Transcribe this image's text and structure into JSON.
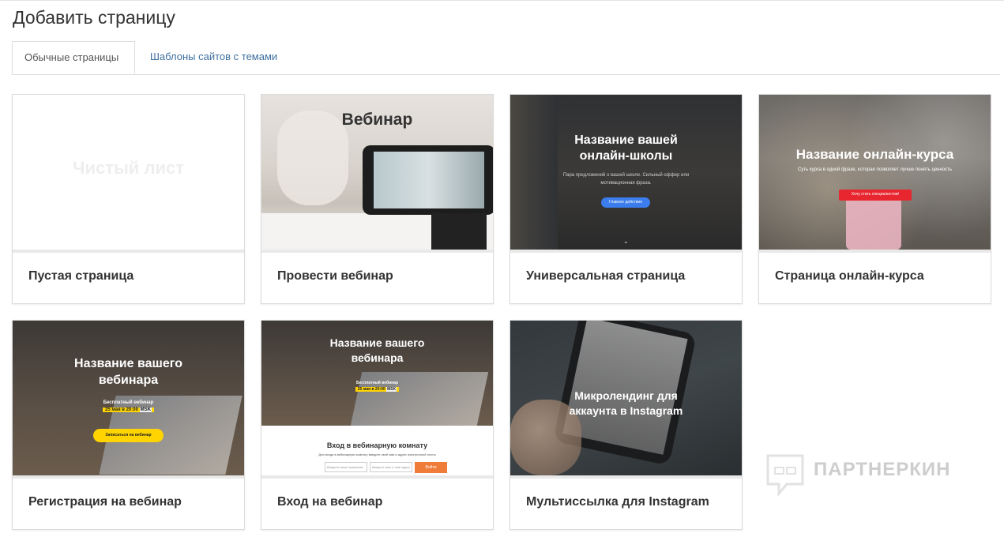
{
  "header": {
    "title": "Добавить страницу"
  },
  "tabs": [
    {
      "label": "Обычные страницы",
      "active": true
    },
    {
      "label": "Шаблоны сайтов с темами",
      "active": false
    }
  ],
  "cards": [
    {
      "label": "Пустая страница",
      "thumb": {
        "placeholder": "Чистый лист"
      }
    },
    {
      "label": "Провести вебинар",
      "thumb": {
        "title": "Вебинар"
      }
    },
    {
      "label": "Универсальная страница",
      "thumb": {
        "title_line1": "Название вашей",
        "title_line2": "онлайн-школы",
        "subtitle": "Пара предложений о вашей школе. Сильный оффер или мотивационная фраза.",
        "button": "Главное действие"
      }
    },
    {
      "label": "Страница онлайн-курса",
      "thumb": {
        "title": "Название онлайн-курса",
        "subtitle": "Суть курса в одной фразе, которая позволяет лучше понять ценность",
        "button": "Хочу стать специалистом!"
      }
    },
    {
      "label": "Регистрация на вебинар",
      "thumb": {
        "title_line1": "Название вашего",
        "title_line2": "вебинара",
        "free": "Бесплатный вебинар",
        "date": "25 мая в 20:00",
        "tz": "MSK",
        "button": "Записаться на вебинар"
      }
    },
    {
      "label": "Вход на вебинар",
      "thumb": {
        "title_line1": "Название вашего",
        "title_line2": "вебинара",
        "free": "Бесплатный вебинар",
        "date": "25 мая в 20:00",
        "tz": "MSK",
        "room_title": "Вход в вебинарную комнату",
        "room_sub": "Для входа в вебинарную комнату введите своё имя и адрес электронной почты",
        "name_ph": "Введите ваше фамилию",
        "email_ph": "Введите ваш e-mail адрес",
        "button": "Войти"
      }
    },
    {
      "label": "Мультиссылка для Instagram",
      "thumb": {
        "title_line1": "Микролендинг для",
        "title_line2": "аккаунта в Instagram"
      }
    }
  ],
  "watermark": {
    "text": "ПАРТНЕРКИН"
  },
  "colors": {
    "link": "#3f6f9f",
    "accent_blue": "#3b7ded",
    "accent_red": "#e8262f",
    "accent_yellow": "#ffd400",
    "accent_orange": "#f07c3a"
  }
}
